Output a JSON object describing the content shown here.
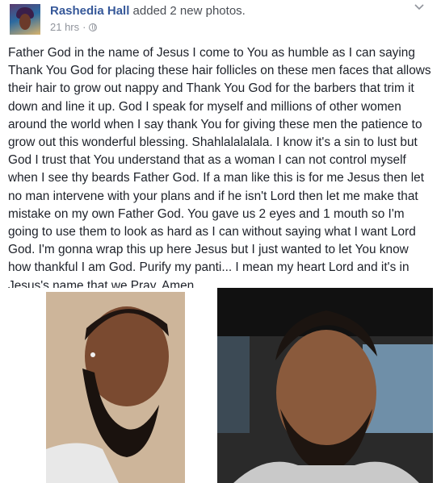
{
  "post": {
    "author": "Rashedia Hall",
    "action": "added 2 new photos.",
    "timestamp": "21 hrs",
    "separator": "·",
    "privacy_icon": "globe-icon",
    "menu_icon": "chevron-down-icon",
    "text": "Father God in the name of Jesus I come to You as humble as I can saying Thank You God for placing these hair follicles on these men faces that allows their hair to grow out nappy and Thank You God for the barbers that trim it down and line it up. God I speak for myself and millions of other women around the world when I say thank You for giving these men the patience to grow out this wonderful blessing. Shahlalalalala. I know it's a sin to lust but God I trust that You understand that as a woman I can not control myself when I see thy beards Father God. If a man like this is for me Jesus then let no man intervene with your plans and if he isn't Lord then let me make that mistake on my own Father God. You gave us 2 eyes and 1 mouth so I'm going to use them to look as hard as I can without saying what I want Lord God. I'm gonna wrap this up here Jesus but I just wanted to let You know how thankful I am God. Purify my panti... I mean my heart Lord and it's in Jesus's name that we Pray. Amen."
  },
  "colors": {
    "name": "#365899",
    "meta": "#90949c",
    "text": "#1d2129"
  }
}
